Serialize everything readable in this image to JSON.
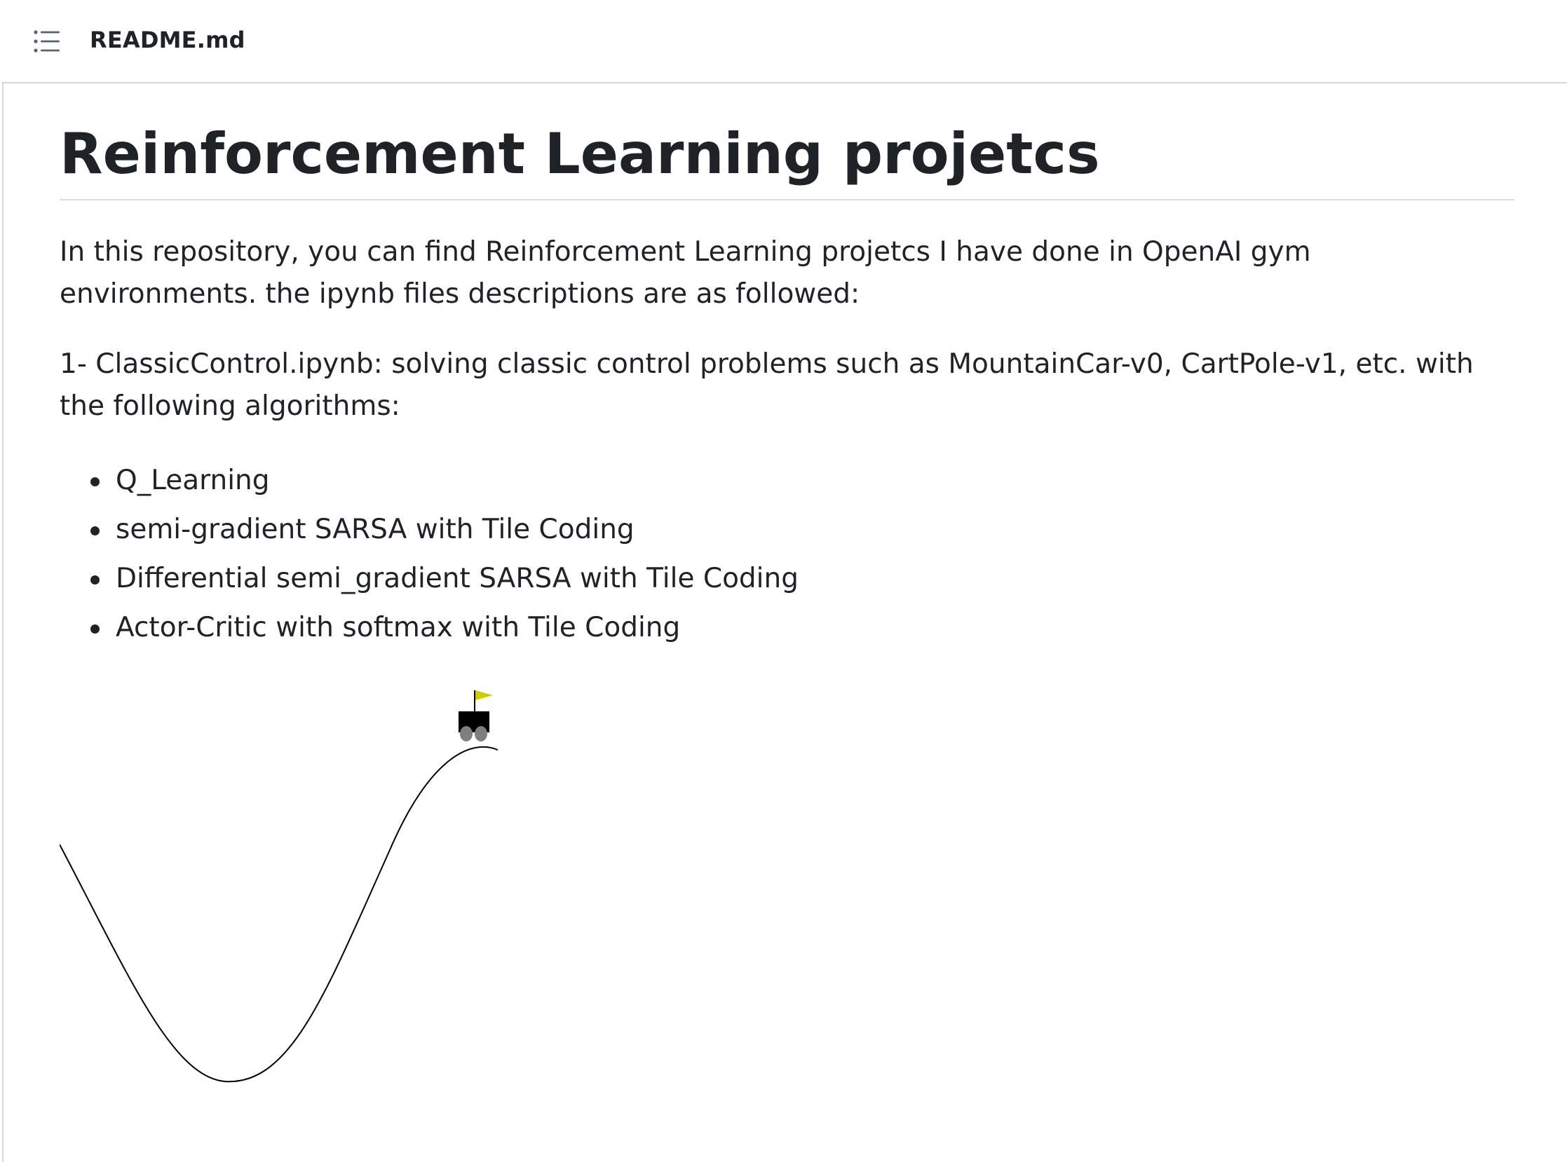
{
  "file_header": {
    "file_name": "README.md",
    "toc_icon": "list-unordered-icon"
  },
  "readme": {
    "title": "Reinforcement Learning projetcs",
    "intro": "In this repository, you can find Reinforcement Learning projetcs I have done in OpenAI gym environments. the ipynb files descriptions are as followed:",
    "item1": "1- ClassicControl.ipynb: solving classic control problems such as MountainCar-v0, CartPole-v1, etc. with the following algorithms:",
    "algorithms": [
      "Q_Learning",
      "semi-gradient SARSA with Tile Coding",
      "Differential semi_gradient SARSA with Tile Coding",
      "Actor-Critic with softmax with Tile Coding"
    ]
  },
  "animation": {
    "name": "mountain-car-animation",
    "flag_color": "#cccc00",
    "car_color": "#000000",
    "wheel_color": "#7f7f7f"
  }
}
